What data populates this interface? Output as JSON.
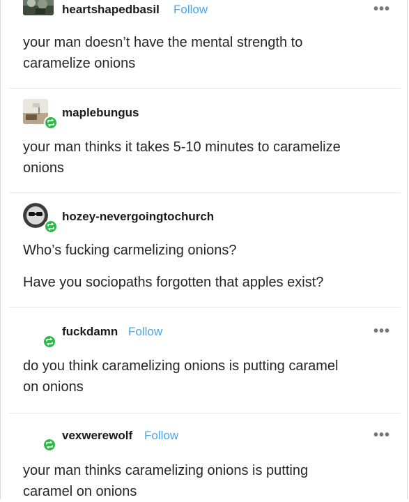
{
  "posts": [
    {
      "username": "heartshapedbasil",
      "follow_label": "Follow",
      "menu_label": "•••",
      "text": [
        "your man doesn’t have the mental strength to",
        "caramelize onions"
      ]
    },
    {
      "username": "maplebungus",
      "text": [
        "your man thinks it takes 5-10 minutes to caramelize",
        "onions"
      ]
    },
    {
      "username": "hozey-nevergoingtochurch",
      "text": [
        "Who’s fucking carmelizing onions?",
        "Have you sociopaths forgotten that apples exist?"
      ]
    },
    {
      "username": "fuckdamn",
      "follow_label": "Follow",
      "menu_label": "•••",
      "text": [
        "do you think caramelizing onions is putting caramel",
        "on onions"
      ]
    },
    {
      "username": "vexwerewolf",
      "follow_label": "Follow",
      "menu_label": "•••",
      "text": [
        "your man thinks caramelizing onions is putting",
        "caramel on onions"
      ]
    }
  ],
  "colors": {
    "follow": "#4aa5e8",
    "reblog_badge": "#2fb84a"
  },
  "icons": {
    "reblog": "reblog-icon",
    "menu": "more-options-icon"
  }
}
